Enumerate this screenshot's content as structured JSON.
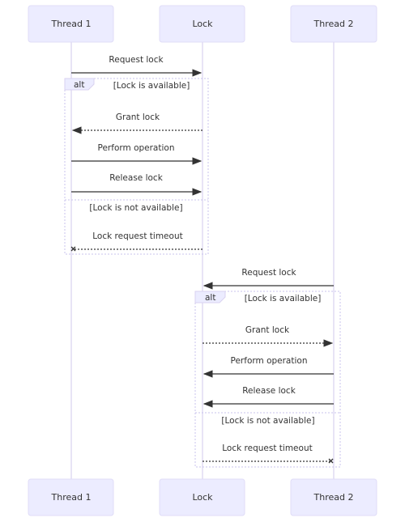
{
  "diagram": {
    "type": "sequence",
    "actors": [
      "Thread 1",
      "Lock",
      "Thread 2"
    ],
    "blocks": [
      {
        "request": {
          "label": "Request lock",
          "from": "Thread 1",
          "to": "Lock",
          "style": "solid"
        },
        "alt": {
          "keyword": "alt",
          "branches": [
            {
              "condition": "[Lock is available]",
              "messages": [
                {
                  "label": "Grant lock",
                  "from": "Lock",
                  "to": "Thread 1",
                  "style": "dotted",
                  "head": "arrow"
                },
                {
                  "label": "Perform operation",
                  "from": "Thread 1",
                  "to": "Lock",
                  "style": "solid",
                  "head": "arrow"
                },
                {
                  "label": "Release lock",
                  "from": "Thread 1",
                  "to": "Lock",
                  "style": "solid",
                  "head": "arrow"
                }
              ]
            },
            {
              "condition": "[Lock is not available]",
              "messages": [
                {
                  "label": "Lock request timeout",
                  "from": "Lock",
                  "to": "Thread 1",
                  "style": "dotted",
                  "head": "cross"
                }
              ]
            }
          ]
        }
      },
      {
        "request": {
          "label": "Request lock",
          "from": "Thread 2",
          "to": "Lock",
          "style": "solid"
        },
        "alt": {
          "keyword": "alt",
          "branches": [
            {
              "condition": "[Lock is available]",
              "messages": [
                {
                  "label": "Grant lock",
                  "from": "Lock",
                  "to": "Thread 2",
                  "style": "dotted",
                  "head": "arrow"
                },
                {
                  "label": "Perform operation",
                  "from": "Thread 2",
                  "to": "Lock",
                  "style": "solid",
                  "head": "arrow"
                },
                {
                  "label": "Release lock",
                  "from": "Thread 2",
                  "to": "Lock",
                  "style": "solid",
                  "head": "arrow"
                }
              ]
            },
            {
              "condition": "[Lock is not available]",
              "messages": [
                {
                  "label": "Lock request timeout",
                  "from": "Lock",
                  "to": "Thread 2",
                  "style": "dotted",
                  "head": "cross"
                }
              ]
            }
          ]
        }
      }
    ]
  }
}
